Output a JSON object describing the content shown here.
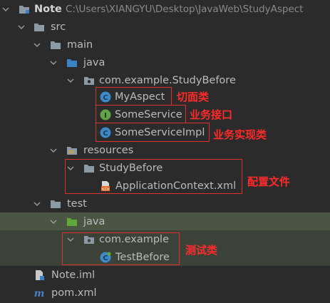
{
  "tree": {
    "root": {
      "label": "Note",
      "path": "C:\\Users\\XIANGYU\\Desktop\\JavaWeb\\StudyAspect"
    },
    "src": "src",
    "main": "main",
    "java_main": "java",
    "package_before": "com.example.StudyBefore",
    "my_aspect": "MyAspect",
    "some_service": "SomeService",
    "some_service_impl": "SomeServiceImpl",
    "resources": "resources",
    "study_before_dir": "StudyBefore",
    "app_context": "ApplicationContext.xml",
    "test": "test",
    "java_test": "java",
    "package_example": "com.example",
    "test_before": "TestBefore",
    "note_iml": "Note.iml",
    "pom": "pom.xml"
  },
  "annotations": {
    "aspect": "切面类",
    "interface": "业务接口",
    "impl": "业务实现类",
    "config": "配置文件",
    "test": "测试类"
  },
  "colors": {
    "background": "#2b2b2b",
    "selected_row": "#4a5543",
    "annotation_red": "#ff2b2b"
  }
}
